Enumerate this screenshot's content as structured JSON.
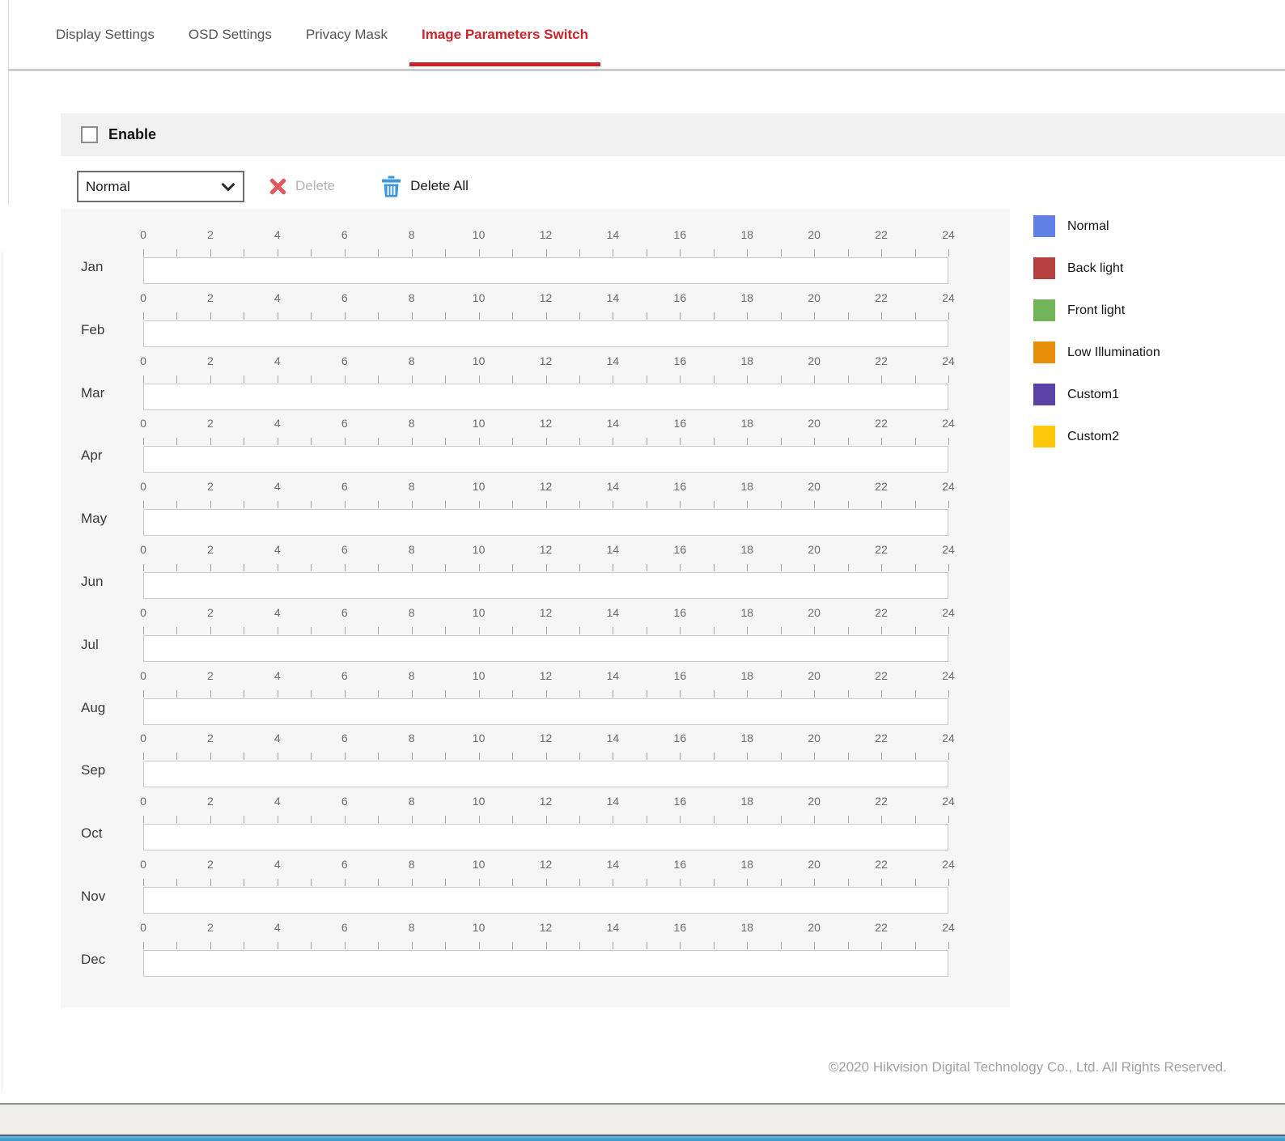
{
  "tabs": {
    "items": [
      {
        "label": "Display Settings",
        "active": false
      },
      {
        "label": "OSD Settings",
        "active": false
      },
      {
        "label": "Privacy Mask",
        "active": false
      },
      {
        "label": "Image Parameters Switch",
        "active": true
      }
    ]
  },
  "enable": {
    "label": "Enable",
    "checked": false
  },
  "toolbar": {
    "mode_select": {
      "value": "Normal"
    },
    "delete_button": {
      "label": "Delete",
      "enabled": false
    },
    "delete_all_button": {
      "label": "Delete All",
      "enabled": true
    }
  },
  "schedule": {
    "months": [
      "Jan",
      "Feb",
      "Mar",
      "Apr",
      "May",
      "Jun",
      "Jul",
      "Aug",
      "Sep",
      "Oct",
      "Nov",
      "Dec"
    ],
    "hour_labels": [
      0,
      2,
      4,
      6,
      8,
      10,
      12,
      14,
      16,
      18,
      20,
      22,
      24
    ],
    "hours_per_day": 24,
    "segments": []
  },
  "legend": {
    "items": [
      {
        "label": "Normal",
        "color": "#6080e6"
      },
      {
        "label": "Back light",
        "color": "#b4403f"
      },
      {
        "label": "Front light",
        "color": "#72b558"
      },
      {
        "label": "Low Illumination",
        "color": "#e88d06"
      },
      {
        "label": "Custom1",
        "color": "#5a41a5"
      },
      {
        "label": "Custom2",
        "color": "#fec80a"
      }
    ]
  },
  "footer": {
    "copyright": "©2020 Hikvision Digital Technology Co., Ltd. All Rights Reserved."
  },
  "theme": {
    "accent_red": "#c9252c",
    "delete_x_red": "#e0595c",
    "trash_blue": "#3d97d9"
  }
}
